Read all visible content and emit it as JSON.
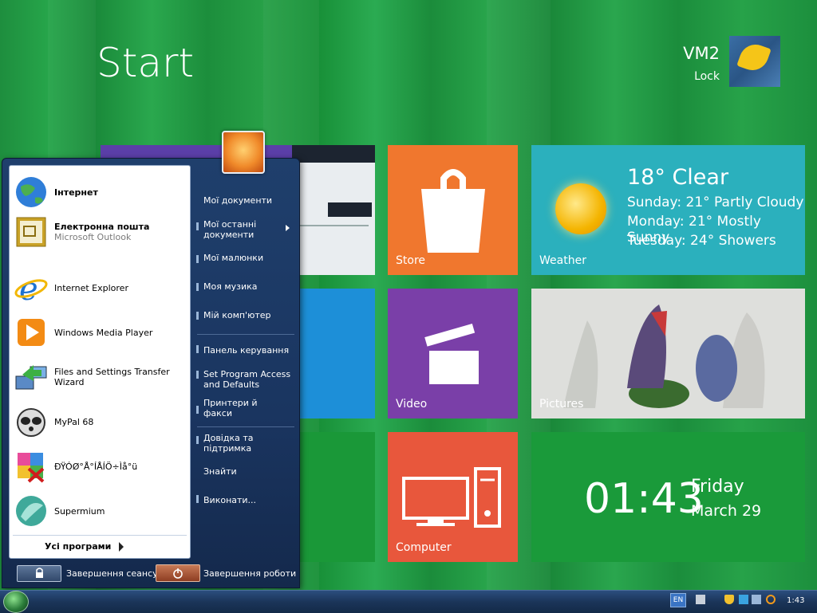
{
  "header": {
    "title": "Start",
    "user_name": "VM2",
    "user_action": "Lock"
  },
  "tiles": {
    "store": {
      "label": "Store"
    },
    "weather": {
      "label": "Weather",
      "current": "18° Clear",
      "forecast": [
        "Sunday: 21° Partly Cloudy",
        "Monday: 21° Mostly Sunny",
        "Tuesday: 24° Showers"
      ]
    },
    "video": {
      "label": "Video"
    },
    "pictures": {
      "label": "Pictures"
    },
    "computer": {
      "label": "Computer"
    },
    "clock": {
      "time": "01:43",
      "day": "Friday",
      "date": "March 29"
    }
  },
  "start_menu": {
    "programs": [
      {
        "name": "Інтернет",
        "icon": "globe-icon",
        "bold": true
      },
      {
        "name": "Електронна пошта",
        "sub": "Microsoft Outlook",
        "icon": "mail-icon",
        "bold": true
      },
      {
        "name": "Internet Explorer",
        "icon": "ie-icon"
      },
      {
        "name": "Windows Media Player",
        "icon": "media-player-icon"
      },
      {
        "name": "Files and Settings Transfer Wizard",
        "icon": "transfer-wizard-icon"
      },
      {
        "name": "MyPal 68",
        "icon": "raccoon-icon"
      },
      {
        "name": "ÐŸÓØ°Å°ÍÅÍÖ÷Ìå°ü",
        "icon": "puzzle-icon"
      },
      {
        "name": "Supermium",
        "icon": "supermium-icon"
      }
    ],
    "all_programs": "Усі програми",
    "right": [
      "Мої документи",
      "Мої останні документи",
      "Мої малюнки",
      "Моя музика",
      "Мій комп'ютер",
      "Панель керування",
      "Set Program Access and Defaults",
      "Принтери й факси",
      "Довідка та підтримка",
      "Знайти",
      "Виконати..."
    ],
    "logoff": "Завершення сеансу",
    "shutdown": "Завершення роботи"
  },
  "taskbar": {
    "lang": "EN",
    "time": "1:43"
  },
  "colors": {
    "store": "#f0772e",
    "weather": "#2bb0bd",
    "video": "#7a3fa8",
    "computer": "#e8573c",
    "clock": "#1a9a3a"
  }
}
